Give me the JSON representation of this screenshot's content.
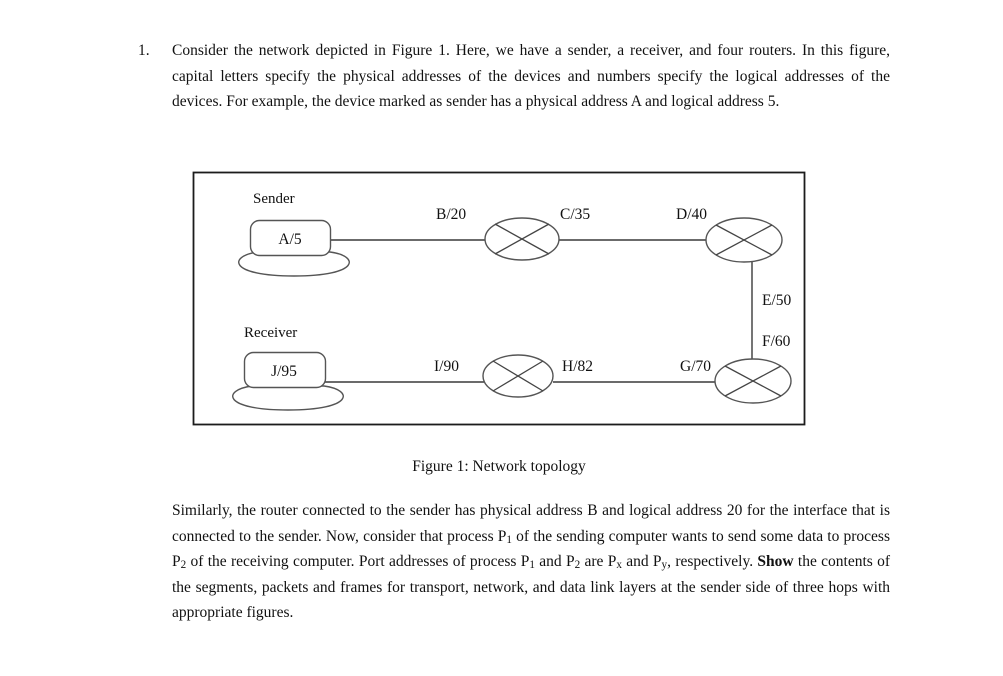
{
  "question": {
    "number": "1.",
    "text": "Consider the network depicted in Figure 1. Here, we have a sender, a receiver, and four routers. In this figure, capital letters specify the physical addresses of the devices and numbers specify the logical addresses of the devices. For example, the device marked as sender has a physical address A and logical address 5."
  },
  "figure": {
    "caption": "Figure 1: Network topology",
    "nodes": {
      "sender_title": "Sender",
      "sender_address": "A/5",
      "receiver_title": "Receiver",
      "receiver_address": "J/95"
    },
    "interface_labels": {
      "b20": "B/20",
      "c35": "C/35",
      "d40": "D/40",
      "e50": "E/50",
      "f60": "F/60",
      "g70": "G/70",
      "h82": "H/82",
      "i90": "I/90"
    }
  },
  "tail": {
    "part1": "Similarly, the router connected to the sender has physical address B and logical address 20 for the interface that is connected to the sender. Now, consider that process P",
    "sub1": "1",
    "part2": " of the sending computer wants to send some data to process P",
    "sub2": "2",
    "part3": " of the receiving computer. Port addresses of process P",
    "sub3": "1",
    "part4": " and P",
    "sub4": "2",
    "part5": " are P",
    "sub5": "x",
    "part6": " and P",
    "sub6": "y",
    "part7": ", respectively. ",
    "bold": "Show",
    "part8": " the contents of the segments, packets and frames for transport, network, and data link layers at the sender side of three hops with appropriate figures."
  },
  "colors": {
    "text": "#111111",
    "line": "#3a3a3a",
    "shape_stroke": "#555555",
    "frame": "#1c1c1c",
    "background": "#ffffff"
  }
}
